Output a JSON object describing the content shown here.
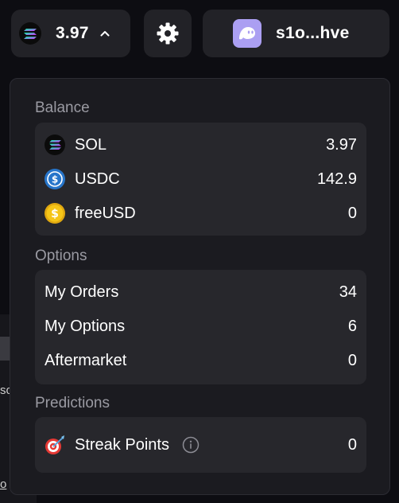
{
  "header": {
    "balance": "3.97",
    "wallet_address": "s1o...hve"
  },
  "balance_section": {
    "title": "Balance",
    "items": [
      {
        "label": "SOL",
        "value": "3.97",
        "icon": "solana-logo-icon"
      },
      {
        "label": "USDC",
        "value": "142.9",
        "icon": "usdc-coin-icon"
      },
      {
        "label": "freeUSD",
        "value": "0",
        "icon": "freeusd-coin-icon"
      }
    ]
  },
  "options_section": {
    "title": "Options",
    "items": [
      {
        "label": "My Orders",
        "value": "34"
      },
      {
        "label": "My Options",
        "value": "6"
      },
      {
        "label": "Aftermarket",
        "value": "0"
      }
    ]
  },
  "predictions_section": {
    "title": "Predictions",
    "items": [
      {
        "label": "Streak Points",
        "value": "0",
        "icon": "dart-target-icon"
      }
    ]
  },
  "background_fragments": [
    "so",
    "o"
  ],
  "colors": {
    "page_bg": "#0d0d12",
    "panel_bg": "#1b1b20",
    "card_bg": "#27272c",
    "pill_bg": "#222227",
    "muted_text": "#9a9aa2",
    "usdc_blue": "#2775ca",
    "freeusd_gold": "#f5c518",
    "phantom_purple": "#ab9ff2"
  }
}
